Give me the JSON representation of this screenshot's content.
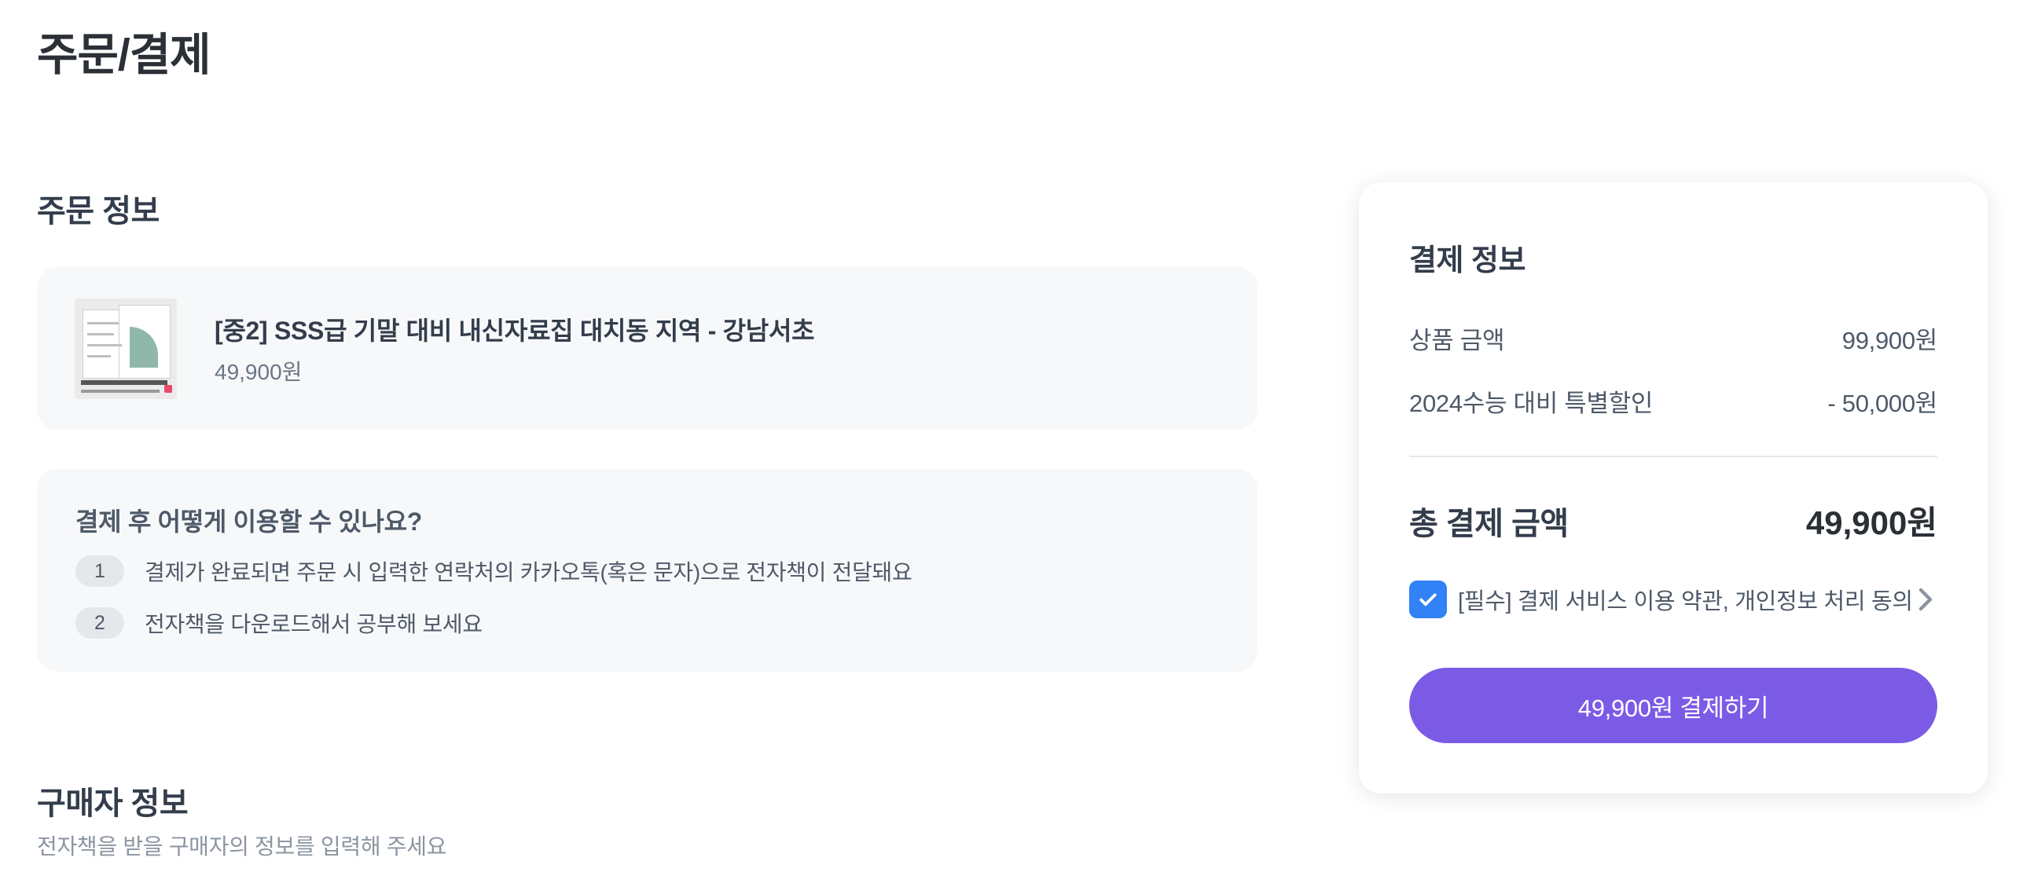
{
  "page": {
    "title": "주문/결제"
  },
  "order_info": {
    "section_title": "주문 정보",
    "product": {
      "name": "[중2] SSS급 기말 대비 내신자료집 대치동 지역 - 강남서초",
      "price": "49,900원"
    }
  },
  "howto": {
    "title": "결제 후 어떻게 이용할 수 있나요?",
    "steps": [
      {
        "num": "1",
        "text": "결제가 완료되면 주문 시 입력한 연락처의 카카오톡(혹은 문자)으로 전자책이 전달돼요"
      },
      {
        "num": "2",
        "text": "전자책을 다운로드해서 공부해 보세요"
      }
    ]
  },
  "buyer": {
    "title": "구매자 정보",
    "subtitle": "전자책을 받을 구매자의 정보를 입력해 주세요"
  },
  "payment": {
    "title": "결제 정보",
    "rows": [
      {
        "label": "상품 금액",
        "value": "99,900원"
      },
      {
        "label": "2024수능 대비 특별할인",
        "value": "- 50,000원"
      }
    ],
    "total_label": "총 결제 금액",
    "total_value": "49,900원",
    "agreement": {
      "text": "[필수] 결제 서비스 이용 약관, 개인정보 처리 동의",
      "checked": true
    },
    "button_label": "49,900원 결제하기"
  },
  "colors": {
    "accent": "#7b5be6",
    "checkbox": "#3182f6",
    "card_bg": "#f7f8fa"
  }
}
